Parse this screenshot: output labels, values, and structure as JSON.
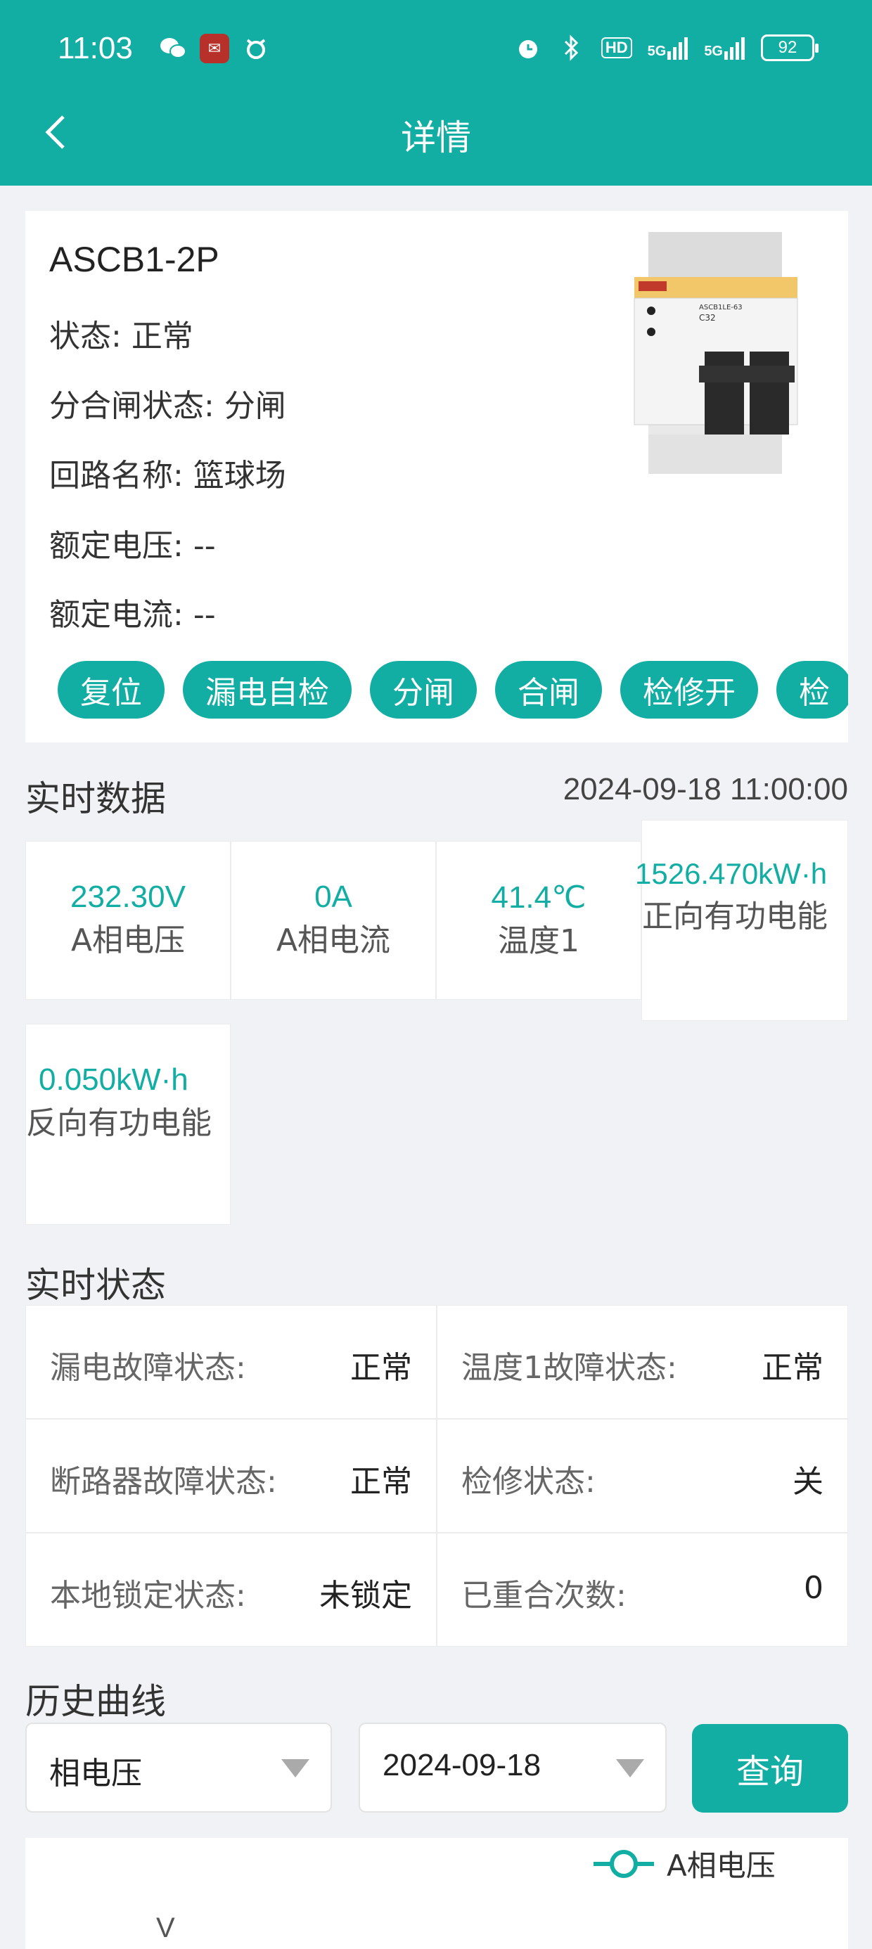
{
  "status_bar": {
    "time": "11:03",
    "network_hd": "HD",
    "signal1": "5G",
    "signal2": "5G",
    "battery": "92"
  },
  "header": {
    "title": "详情"
  },
  "device": {
    "model": "ASCB1-2P",
    "fields": [
      {
        "label": "状态: ",
        "value": "正常"
      },
      {
        "label": "分合闸状态: ",
        "value": "分闸"
      },
      {
        "label": "回路名称: ",
        "value": "篮球场"
      },
      {
        "label": "额定电压: ",
        "value": "--"
      },
      {
        "label": "额定电流: ",
        "value": "--"
      }
    ],
    "image_text": {
      "model": "ASCB1LE-63",
      "rating": "C32"
    },
    "actions": [
      "复位",
      "漏电自检",
      "分闸",
      "合闸",
      "检修开",
      "检"
    ]
  },
  "realtime": {
    "title": "实时数据",
    "timestamp": "2024-09-18 11:00:00",
    "metrics": [
      {
        "value": "232.30V",
        "label": "A相电压"
      },
      {
        "value": "0A",
        "label": "A相电流"
      },
      {
        "value": "41.4℃",
        "label": "温度1"
      },
      {
        "value": "1526.470kW·h",
        "label": "正向有功电能"
      },
      {
        "value": "0.050kW·h",
        "label": "反向有功电能"
      }
    ]
  },
  "status": {
    "title": "实时状态",
    "items": [
      {
        "label": "漏电故障状态:",
        "value": "正常"
      },
      {
        "label": "温度1故障状态:",
        "value": "正常"
      },
      {
        "label": "断路器故障状态:",
        "value": "正常"
      },
      {
        "label": "检修状态:",
        "value": "关"
      },
      {
        "label": "本地锁定状态:",
        "value": "未锁定"
      },
      {
        "label": "已重合次数:",
        "value": "0"
      }
    ]
  },
  "history": {
    "title": "历史曲线",
    "type_select": "相电压",
    "date_select": "2024-09-18",
    "query_label": "查询",
    "legend": "A相电压",
    "y_unit": "V"
  },
  "colors": {
    "accent": "#12ada3"
  }
}
